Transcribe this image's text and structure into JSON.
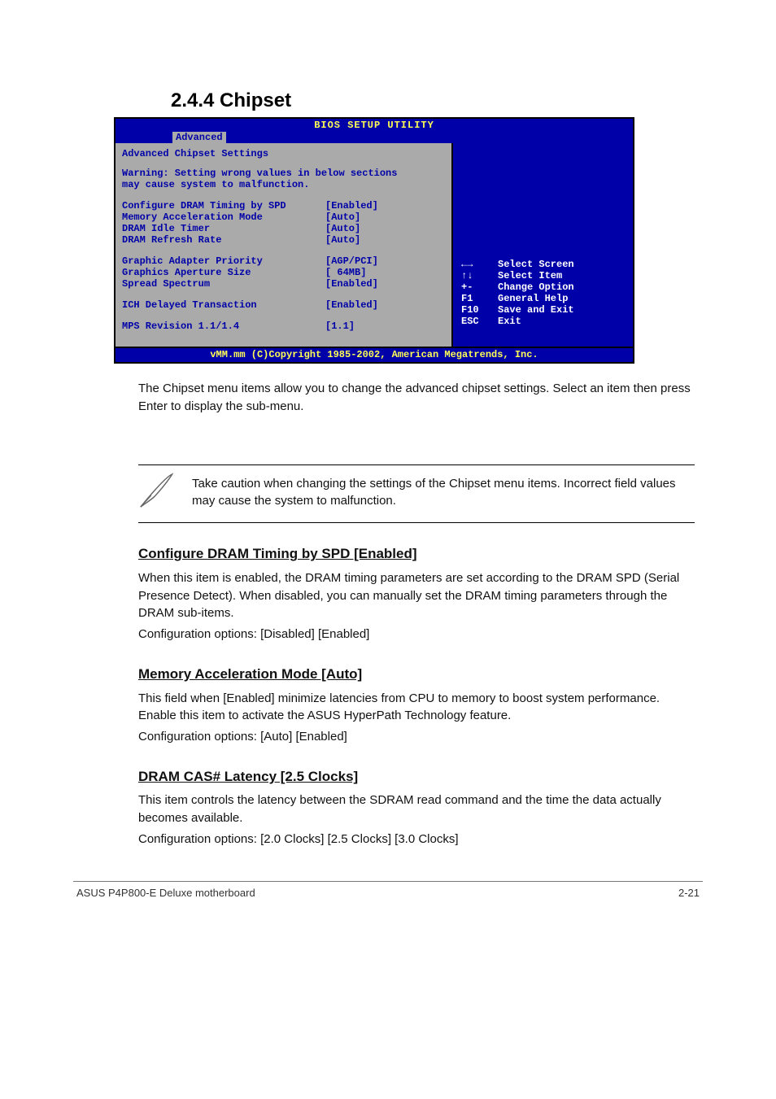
{
  "section_title": "2.4.4 Chipset",
  "bios": {
    "title": "BIOS SETUP UTILITY",
    "tab": "Advanced",
    "main_heading": "Advanced Chipset Settings",
    "warning_line1": "Warning: Setting wrong values in below sections",
    "warning_line2": "         may cause system to malfunction.",
    "group1": [
      {
        "label": "Configure DRAM Timing by SPD",
        "value": "[Enabled]"
      },
      {
        "label": "Memory Acceleration Mode",
        "value": "[Auto]"
      },
      {
        "label": "DRAM Idle Timer",
        "value": "[Auto]"
      },
      {
        "label": "DRAM Refresh Rate",
        "value": "[Auto]"
      }
    ],
    "group2": [
      {
        "label": "Graphic Adapter Priority",
        "value": "[AGP/PCI]"
      },
      {
        "label": "Graphics Aperture Size",
        "value": "[ 64MB]"
      },
      {
        "label": "Spread Spectrum",
        "value": "[Enabled]"
      }
    ],
    "group3": [
      {
        "label": "ICH Delayed Transaction",
        "value": "[Enabled]"
      }
    ],
    "group4": [
      {
        "label": "MPS Revision",
        "value": "[1.1]"
      }
    ],
    "mps_label_display": "MPS Revision 1.1/1.4",
    "mps_value_display": "[1.1]",
    "legend": [
      {
        "key": "←→",
        "action": "Select Screen"
      },
      {
        "key": "↑↓",
        "action": "Select Item"
      },
      {
        "key": "+-",
        "action": "Change Option"
      },
      {
        "key": "F1",
        "action": "General Help"
      },
      {
        "key": "F10",
        "action": "Save and Exit"
      },
      {
        "key": "ESC",
        "action": "Exit"
      }
    ],
    "footer": "vMM.mm (C)Copyright 1985-2002, American Megatrends, Inc."
  },
  "doc": {
    "intro": "The Chipset menu items allow you to change the advanced chipset settings. Select an item then press Enter to display the sub-menu.",
    "note": "Take caution when changing the settings of the Chipset menu items. Incorrect field values may cause the system to malfunction.",
    "items": [
      {
        "title": "Configure DRAM Timing by SPD [Enabled]",
        "body1": "When this item is enabled, the DRAM timing parameters are set according to the DRAM SPD (Serial Presence Detect). When disabled, you can manually set the DRAM timing parameters through the DRAM sub-items.",
        "body2": "Configuration options: [Disabled] [Enabled]"
      },
      {
        "title": "Memory Acceleration Mode [Auto]",
        "body1": "This field when [Enabled] minimize latencies from CPU to memory to boost system performance. Enable this item to activate the ASUS HyperPath Technology feature.",
        "body2": "Configuration options: [Auto] [Enabled]"
      },
      {
        "title": "DRAM CAS# Latency [2.5 Clocks]",
        "body1": "This item controls the latency between the SDRAM read command and the time the data actually becomes available.",
        "body2": "Configuration options: [2.0 Clocks] [2.5 Clocks] [3.0 Clocks]"
      }
    ]
  },
  "footer": {
    "left": "ASUS P4P800-E Deluxe motherboard",
    "right": "2-21"
  }
}
